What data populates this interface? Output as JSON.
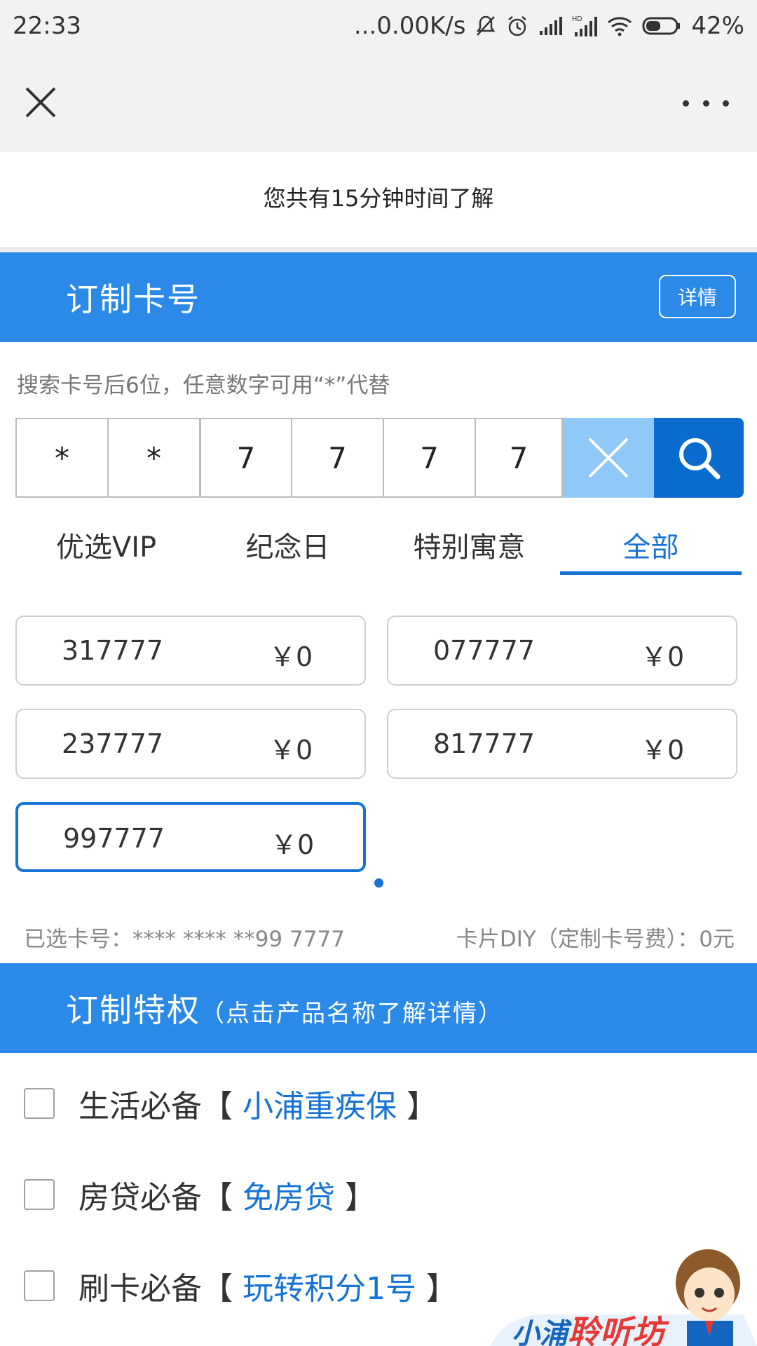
{
  "status_bar": {
    "time": "22:33",
    "network_speed": "...0.00K/s",
    "battery": "42%",
    "icons": [
      "mute-icon",
      "alarm-icon",
      "signal-icon",
      "hd-signal-icon",
      "wifi-icon",
      "battery-icon"
    ]
  },
  "title_bar": {
    "close_icon": "close-icon",
    "more_icon": "more-icon"
  },
  "notice": "您共有15分钟时间了解",
  "card_section": {
    "title": "订制卡号",
    "details_label": "详情",
    "hint": "搜索卡号后6位，任意数字可用“*”代替",
    "digits": [
      "*",
      "*",
      "7",
      "7",
      "7",
      "7"
    ],
    "tabs": [
      {
        "label": "优选VIP",
        "active": false
      },
      {
        "label": "纪念日",
        "active": false
      },
      {
        "label": "特别寓意",
        "active": false
      },
      {
        "label": "全部",
        "active": true
      }
    ],
    "numbers": [
      {
        "number": "317777",
        "price": "￥0",
        "selected": false
      },
      {
        "number": "077777",
        "price": "￥0",
        "selected": false
      },
      {
        "number": "237777",
        "price": "￥0",
        "selected": false
      },
      {
        "number": "817777",
        "price": "￥0",
        "selected": false
      },
      {
        "number": "997777",
        "price": "￥0",
        "selected": true
      }
    ],
    "selected_label": "已选卡号：**** **** **99 7777",
    "fee_label": "卡片DIY（定制卡号费）：0元"
  },
  "privilege_section": {
    "title": "订制特权",
    "subtitle": "（点击产品名称了解详情）",
    "items": [
      {
        "prefix": "生活必备【 ",
        "link": "小浦重疾保",
        "suffix": " 】"
      },
      {
        "prefix": "房贷必备【 ",
        "link": "免房贷",
        "suffix": " 】"
      },
      {
        "prefix": "刷卡必备【 ",
        "link": "玩转积分1号",
        "suffix": " 】"
      }
    ]
  },
  "mascot": {
    "text": "小浦聆听坊"
  },
  "colors": {
    "brand_blue": "#2b8ae8",
    "active_blue": "#1673d6",
    "search_blue": "#0a6bcf",
    "clear_light_blue": "#90c8f8"
  }
}
